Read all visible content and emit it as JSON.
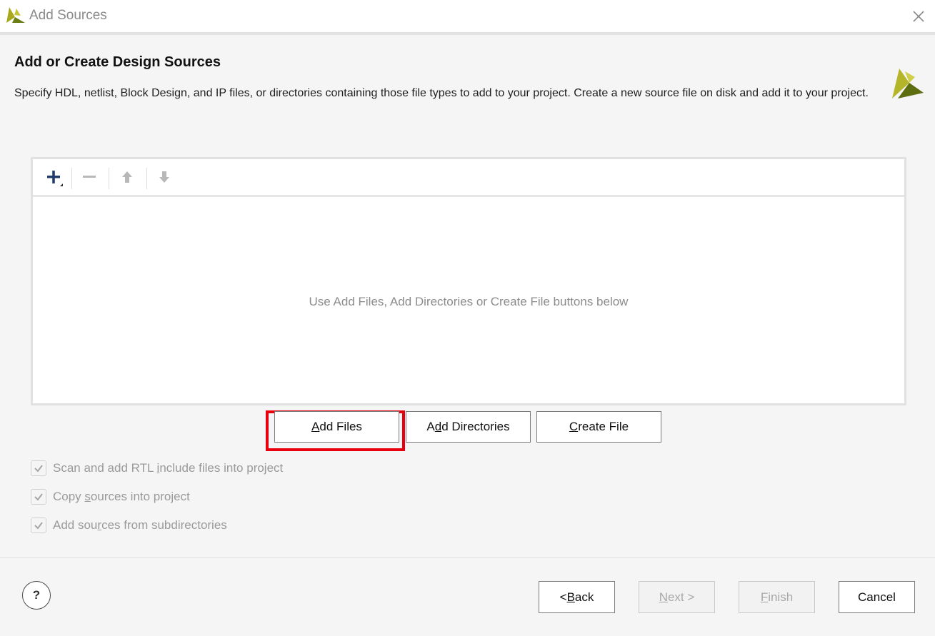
{
  "window": {
    "title": "Add Sources",
    "app_icon": "vivado-logo-icon",
    "close_icon": "close-icon"
  },
  "page": {
    "heading": "Add or Create Design Sources",
    "description": "Specify HDL, netlist, Block Design, and IP files, or directories containing those file types to add to your project. Create a new source file on disk and add it to your project."
  },
  "toolbar": {
    "add_icon": "plus-icon",
    "remove_icon": "minus-icon",
    "up_icon": "arrow-up-icon",
    "down_icon": "arrow-down-icon"
  },
  "file_list": {
    "empty_hint": "Use Add Files, Add Directories or Create File buttons below",
    "items": []
  },
  "actions": {
    "add_files": {
      "pre": "",
      "mnemonic": "A",
      "post": "dd Files"
    },
    "add_directories": {
      "pre": "A",
      "mnemonic": "d",
      "post": "d Directories"
    },
    "create_file": {
      "pre": "",
      "mnemonic": "C",
      "post": "reate File"
    }
  },
  "options": [
    {
      "pre": "Scan and add RTL ",
      "mnemonic": "i",
      "post": "nclude files into project",
      "checked": true
    },
    {
      "pre": "Copy ",
      "mnemonic": "s",
      "post": "ources into project",
      "checked": true
    },
    {
      "pre": "Add sou",
      "mnemonic": "r",
      "post": "ces from subdirectories",
      "checked": true
    }
  ],
  "footer": {
    "help_label": "?",
    "back": {
      "pre": "< ",
      "mnemonic": "B",
      "post": "ack"
    },
    "next": {
      "pre": "",
      "mnemonic": "N",
      "post": "ext >"
    },
    "finish": {
      "pre": "",
      "mnemonic": "F",
      "post": "inish"
    },
    "cancel": "Cancel"
  },
  "colors": {
    "highlight": "#e8000f",
    "logo_yellow_green": "#a8a81c",
    "logo_dark_green": "#5c6e10"
  }
}
